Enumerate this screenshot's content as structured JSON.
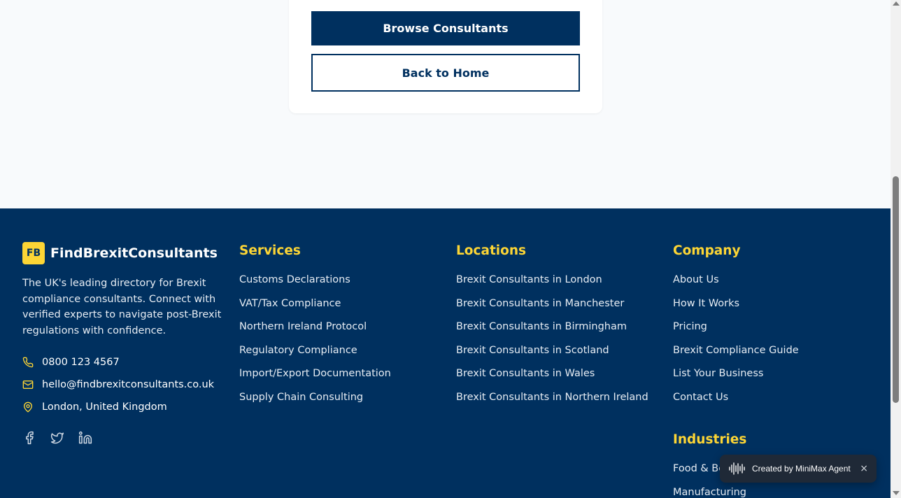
{
  "actions": {
    "browse_label": "Browse Consultants",
    "home_label": "Back to Home"
  },
  "footer": {
    "brand": {
      "logo": "FB",
      "name": "FindBrexitConsultants",
      "description": "The UK's leading directory for Brexit compliance consultants. Connect with verified experts to navigate post-Brexit regulations with confidence."
    },
    "contact": {
      "phone": "0800 123 4567",
      "email": "hello@findbrexitconsultants.co.uk",
      "location": "London, United Kingdom"
    },
    "socials": [
      "facebook-icon",
      "twitter-icon",
      "linkedin-icon"
    ],
    "services": {
      "title": "Services",
      "items": [
        "Customs Declarations",
        "VAT/Tax Compliance",
        "Northern Ireland Protocol",
        "Regulatory Compliance",
        "Import/Export Documentation",
        "Supply Chain Consulting"
      ]
    },
    "locations": {
      "title": "Locations",
      "items": [
        "Brexit Consultants in London",
        "Brexit Consultants in Manchester",
        "Brexit Consultants in Birmingham",
        "Brexit Consultants in Scotland",
        "Brexit Consultants in Wales",
        "Brexit Consultants in Northern Ireland"
      ]
    },
    "company": {
      "title": "Company",
      "items": [
        "About Us",
        "How It Works",
        "Pricing",
        "Brexit Compliance Guide",
        "List Your Business",
        "Contact Us"
      ]
    },
    "industries": {
      "title": "Industries",
      "items": [
        "Food & Be",
        "Manufacturing"
      ]
    }
  },
  "toast": {
    "text": "Created by MiniMax Agent",
    "close": "×"
  },
  "colors": {
    "navy": "#00305f",
    "accent": "#fcd535",
    "background": "#f8fafc"
  }
}
